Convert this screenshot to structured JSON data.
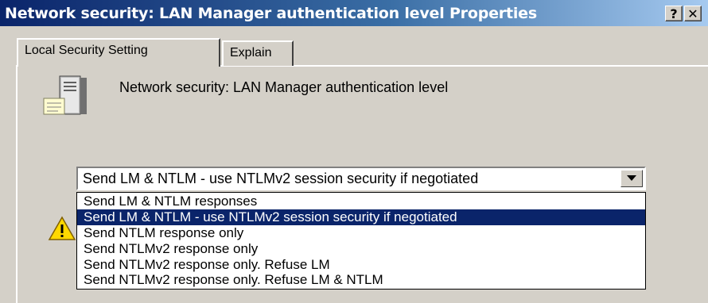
{
  "window": {
    "title": "Network security: LAN Manager authentication level Properties",
    "help_label": "?",
    "close_label": "✕"
  },
  "tabs": [
    {
      "label": "Local Security Setting",
      "active": true
    },
    {
      "label": "Explain",
      "active": false
    }
  ],
  "policy": {
    "name": "Network security: LAN Manager authentication level",
    "icon": "server-icon"
  },
  "combo": {
    "selected": "Send LM & NTLM - use NTLMv2 session security if negotiated",
    "arrow_icon": "chevron-down-icon",
    "options": [
      "Send LM & NTLM responses",
      "Send LM & NTLM - use NTLMv2 session security if negotiated",
      "Send NTLM response only",
      "Send NTLMv2 response only",
      "Send NTLMv2 response only. Refuse LM",
      "Send NTLMv2 response only. Refuse LM & NTLM"
    ],
    "highlighted_index": 1
  },
  "warning": {
    "icon": "warning-icon"
  },
  "colors": {
    "titlebar_start": "#0a246a",
    "titlebar_end": "#a6caf0",
    "dialog_bg": "#d4d0c8",
    "selection_bg": "#0a246a"
  }
}
